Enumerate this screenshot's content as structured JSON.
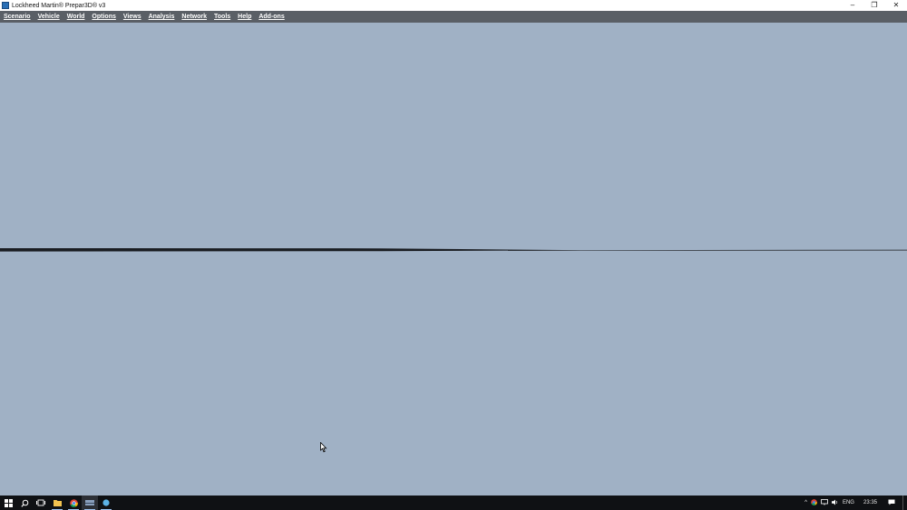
{
  "window": {
    "title": "Lockheed Martin® Prepar3D® v3",
    "controls": {
      "minimize": "–",
      "restore": "❐",
      "close": "✕"
    }
  },
  "menu": {
    "items": [
      {
        "label": "Scenario"
      },
      {
        "label": "Vehicle"
      },
      {
        "label": "World"
      },
      {
        "label": "Options"
      },
      {
        "label": "Views"
      },
      {
        "label": "Analysis"
      },
      {
        "label": "Network"
      },
      {
        "label": "Tools"
      },
      {
        "label": "Help"
      },
      {
        "label": "Add-ons"
      }
    ]
  },
  "viewport": {
    "sky_color": "#a0b1c5",
    "horizon_color": "#1a1d22"
  },
  "taskbar": {
    "apps": [
      {
        "icon": "windows-start-icon"
      },
      {
        "icon": "search-icon"
      },
      {
        "icon": "task-view-icon"
      },
      {
        "icon": "file-explorer-icon"
      },
      {
        "icon": "chrome-icon"
      },
      {
        "icon": "prepar3d-icon"
      },
      {
        "icon": "app-icon"
      }
    ],
    "tray": {
      "language": "ENG",
      "time": "23:35"
    }
  }
}
